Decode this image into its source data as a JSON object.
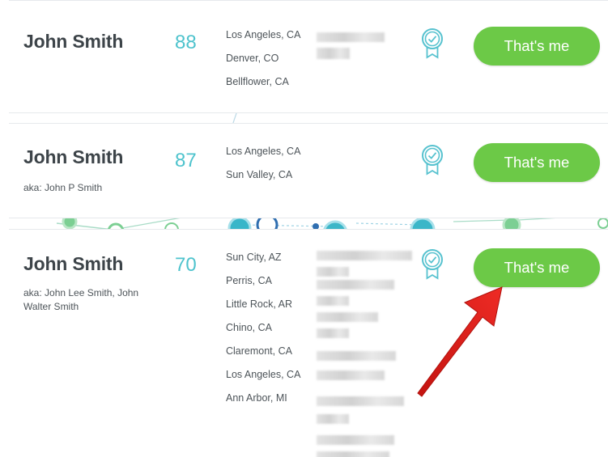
{
  "results": [
    {
      "name": "John Smith",
      "score": "88",
      "aka": "",
      "cities": [
        "Los Angeles, CA",
        "Denver, CO",
        "Bellflower, CA"
      ],
      "button_label": "That's me"
    },
    {
      "name": "John Smith",
      "score": "87",
      "aka": "aka: John P Smith",
      "cities": [
        "Los Angeles, CA",
        "Sun Valley, CA"
      ],
      "button_label": "That's me"
    },
    {
      "name": "John Smith",
      "score": "70",
      "aka": "aka: John Lee Smith, John Walter Smith",
      "cities": [
        "Sun City, AZ",
        "Perris, CA",
        "Little Rock, AR",
        "Chino, CA",
        "Claremont, CA",
        "Los Angeles, CA",
        "Ann Arbor, MI"
      ],
      "button_label": "That's me"
    }
  ],
  "icons": {
    "badge": "verified-badge-icon",
    "annotation": "red-arrow-annotation"
  },
  "colors": {
    "button_green": "#6cc947",
    "score_teal": "#4ec3cd",
    "name_text": "#3d4449",
    "arrow_red": "#e0211c"
  }
}
